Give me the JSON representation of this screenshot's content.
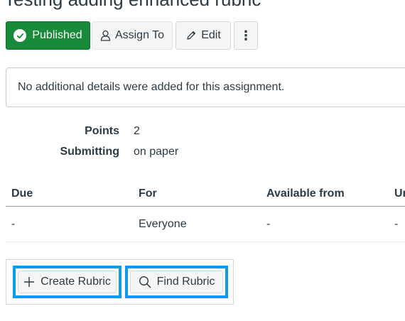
{
  "page": {
    "title": "Testing adding enhanced rubric"
  },
  "toolbar": {
    "published_label": "Published",
    "assign_label": "Assign To",
    "edit_label": "Edit",
    "more_label": "⋮"
  },
  "details": {
    "text": "No additional details were added for this assignment."
  },
  "meta": [
    {
      "label": "Points",
      "value": "2"
    },
    {
      "label": "Submitting",
      "value": "on paper"
    }
  ],
  "dates": {
    "headers": [
      "Due",
      "For",
      "Available from",
      "Ur"
    ],
    "rows": [
      [
        "-",
        "Everyone",
        "-",
        "-"
      ]
    ]
  },
  "rubric": {
    "create_label": "Create Rubric",
    "find_label": "Find Rubric"
  },
  "colors": {
    "published_green": "#188a3a",
    "focus_blue": "#0b9bef",
    "text": "#2d3b45"
  }
}
